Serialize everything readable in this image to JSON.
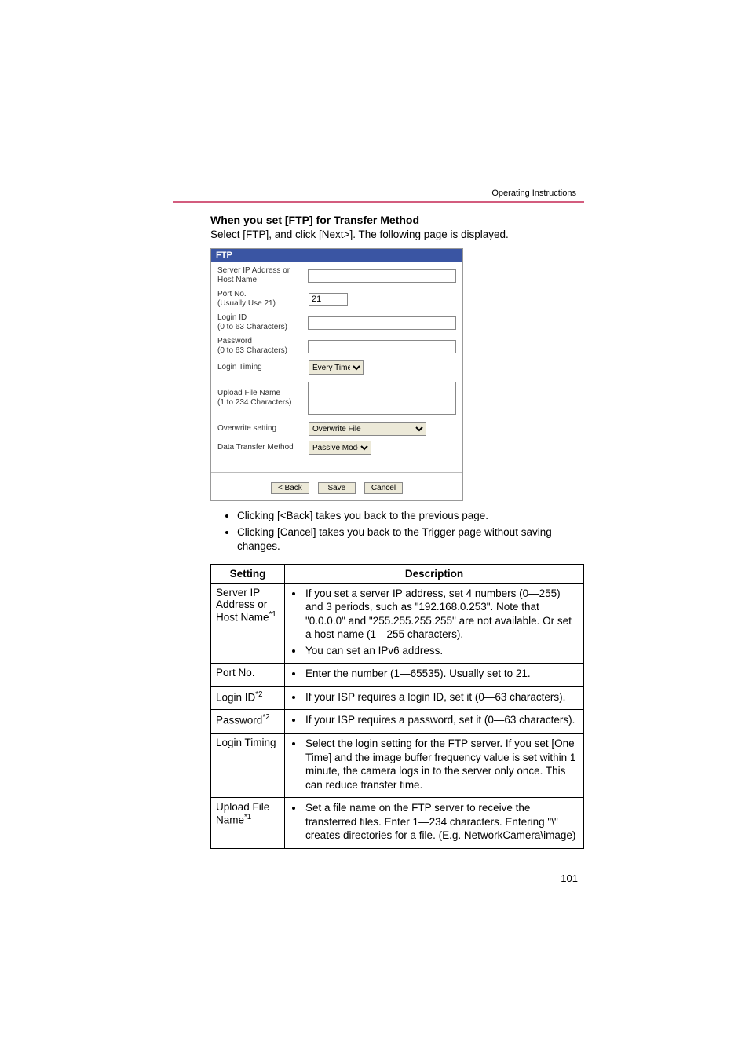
{
  "headerLabel": "Operating Instructions",
  "sectionTitle": "When you set [FTP] for Transfer Method",
  "introText": "Select [FTP], and click [Next>]. The following page is displayed.",
  "form": {
    "title": "FTP",
    "labels": {
      "server": "Server IP Address or Host Name",
      "port": "Port No.\n(Usually Use 21)",
      "login": "Login ID\n(0 to 63 Characters)",
      "password": "Password\n(0 to 63 Characters)",
      "timing": "Login Timing",
      "upload": "Upload File Name\n(1 to 234 Characters)",
      "overwrite": "Overwrite setting",
      "transfer": "Data Transfer Method"
    },
    "values": {
      "portNo": "21",
      "loginTiming": "Every Time",
      "overwrite": "Overwrite File",
      "transfer": "Passive Mode"
    },
    "buttons": {
      "back": "< Back",
      "save": "Save",
      "cancel": "Cancel"
    }
  },
  "bullets": [
    "Clicking [<Back] takes you back to the previous page.",
    "Clicking [Cancel] takes you back to the Trigger page without saving changes."
  ],
  "table": {
    "headers": {
      "setting": "Setting",
      "description": "Description"
    },
    "rows": [
      {
        "setting": {
          "text": "Server IP Address or Host Name",
          "sup": "*1"
        },
        "desc": [
          "If you set a server IP address, set 4 numbers (0—255) and 3 periods, such as \"192.168.0.253\". Note that \"0.0.0.0\" and \"255.255.255.255\" are not available. Or set a host name (1—255 characters).",
          "You can set an IPv6 address."
        ]
      },
      {
        "setting": {
          "text": "Port No."
        },
        "desc": [
          "Enter the number (1—65535). Usually set to 21."
        ]
      },
      {
        "setting": {
          "text": "Login ID",
          "sup": "*2"
        },
        "desc": [
          "If your ISP requires a login ID, set it (0—63 characters)."
        ]
      },
      {
        "setting": {
          "text": "Password",
          "sup": "*2"
        },
        "desc": [
          "If your ISP requires a password, set it (0—63 characters)."
        ]
      },
      {
        "setting": {
          "text": "Login Timing"
        },
        "desc": [
          "Select the login setting for the FTP server. If you set [One Time] and the image buffer frequency value is set within 1 minute, the camera logs in to the server only once. This can reduce transfer time."
        ]
      },
      {
        "setting": {
          "text": "Upload File Name",
          "sup": "*1"
        },
        "desc": [
          "Set a file name on the FTP server to receive the transferred files. Enter 1—234 characters. Entering \"\\\" creates directories for a file. (E.g. NetworkCamera\\image)"
        ]
      }
    ]
  },
  "pageNumber": "101"
}
